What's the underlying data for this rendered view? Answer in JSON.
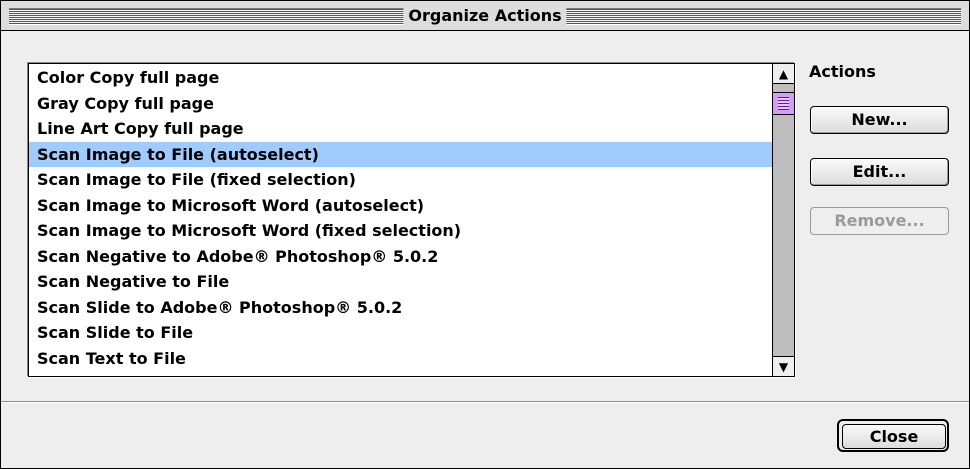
{
  "window": {
    "title": "Organize Actions"
  },
  "list": {
    "items": [
      "Color Copy full page",
      "Gray Copy full page",
      "Line Art Copy full page",
      "Scan Image to File (autoselect)",
      "Scan Image to File (fixed selection)",
      "Scan Image to Microsoft Word (autoselect)",
      "Scan Image to Microsoft Word (fixed selection)",
      "Scan Negative to Adobe® Photoshop® 5.0.2",
      "Scan Negative to File",
      "Scan Slide to Adobe® Photoshop® 5.0.2",
      "Scan Slide to File",
      "Scan Text to File"
    ],
    "selected_index": 3
  },
  "actions": {
    "label": "Actions",
    "new_label": "New...",
    "edit_label": "Edit...",
    "remove_label": "Remove..."
  },
  "footer": {
    "close_label": "Close"
  },
  "colors": {
    "selection": "#9fcbff",
    "scroll_thumb": "#d79bff"
  },
  "icons": {
    "scroll_up": "scroll-up-arrow-icon",
    "scroll_down": "scroll-down-arrow-icon"
  }
}
